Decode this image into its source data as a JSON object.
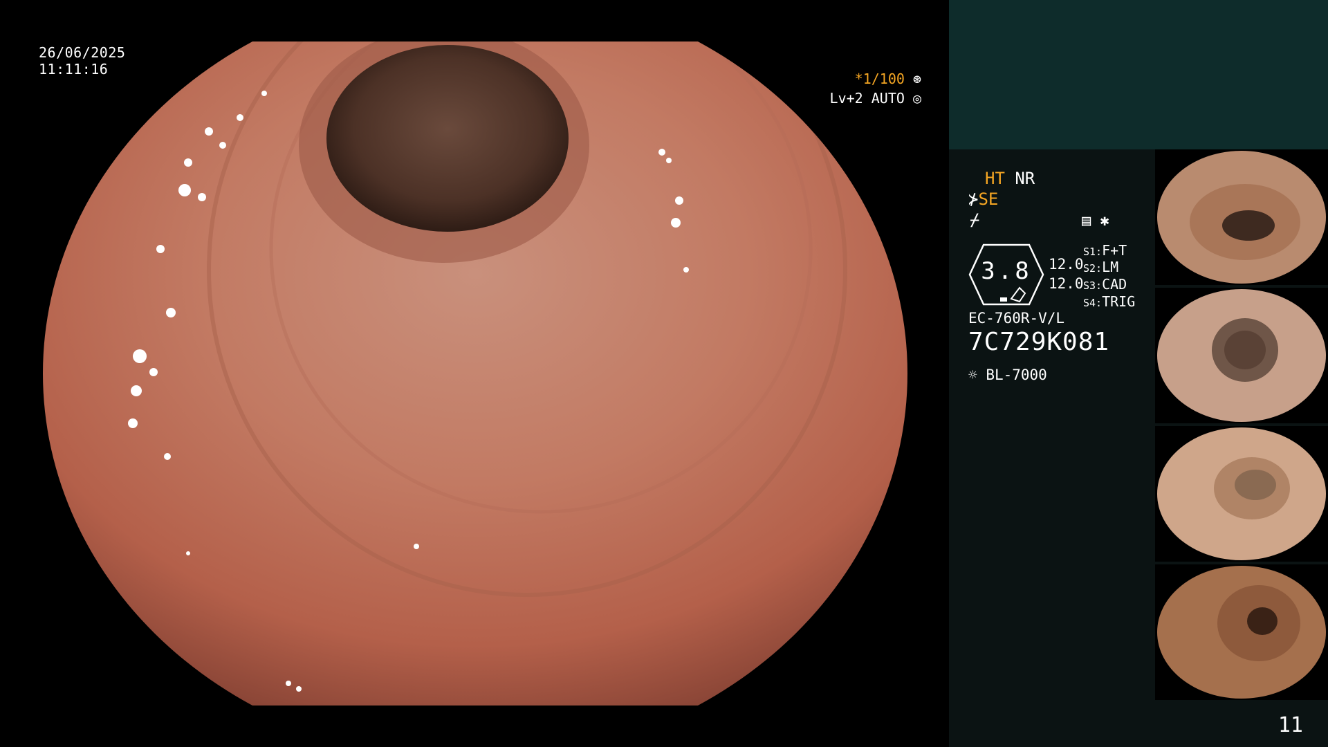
{
  "overlay": {
    "date": "26/06/2025",
    "time": "11:11:16",
    "shutter": "*1/100",
    "level": "Lv+2 AUTO"
  },
  "settings": {
    "ht": "HT",
    "nr": "NR",
    "se": "SE",
    "gain_top": "12.0",
    "gain_bottom": "12.0",
    "zoom": "3.8",
    "s1_key": "S1:",
    "s1_val": "F+T",
    "s2_key": "S2:",
    "s2_val": "LM",
    "s3_key": "S3:",
    "s3_val": "CAD",
    "s4_key": "S4:",
    "s4_val": "TRIG",
    "scope_model": "EC-760R-V/L",
    "serial": "7C729K081",
    "light_source": "BL-7000"
  },
  "page_number": "11",
  "colors": {
    "accent_orange": "#f5a623",
    "panel_dark": "#0b1313",
    "panel_teal": "#0e2c2b"
  },
  "icons": [
    "shutter-gear-icon",
    "auto-light-icon",
    "scope-tool-icon",
    "wave-icon",
    "memory-card-icon",
    "asterisk-icon",
    "light-source-icon"
  ]
}
